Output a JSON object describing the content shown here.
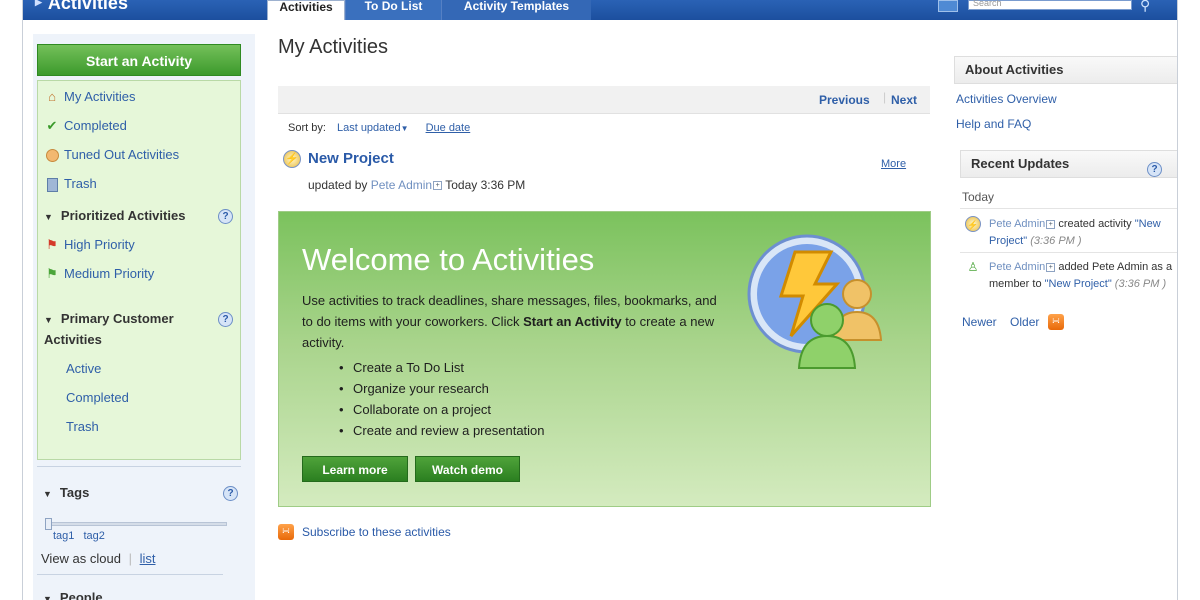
{
  "header": {
    "app_title": "Activities",
    "tabs": [
      {
        "label": "Activities"
      },
      {
        "label": "To Do List"
      },
      {
        "label": "Activity Templates"
      }
    ],
    "search_placeholder": "Search"
  },
  "sidebar": {
    "start_button": "Start an Activity",
    "nav": [
      {
        "label": "My Activities",
        "icon": "home-icon"
      },
      {
        "label": "Completed",
        "icon": "checkmark-icon"
      },
      {
        "label": "Tuned Out Activities",
        "icon": "tuned-out-icon"
      },
      {
        "label": "Trash",
        "icon": "trash-icon"
      }
    ],
    "prioritized": {
      "title": "Prioritized Activities",
      "items": [
        {
          "label": "High Priority",
          "icon": "red-flag-icon"
        },
        {
          "label": "Medium Priority",
          "icon": "green-flag-icon"
        }
      ]
    },
    "primary": {
      "title": "Primary Customer Activities",
      "items": [
        {
          "label": "Active"
        },
        {
          "label": "Completed"
        },
        {
          "label": "Trash"
        }
      ]
    },
    "tags": {
      "title": "Tags",
      "tags": [
        "tag1",
        "tag2"
      ],
      "view_as_cloud": "View as cloud",
      "list_link": "list"
    },
    "people": {
      "title": "People"
    }
  },
  "main": {
    "title": "My Activities",
    "pager": {
      "previous": "Previous",
      "next": "Next"
    },
    "sort": {
      "label": "Sort by:",
      "last_updated": "Last updated",
      "due_date": "Due date"
    },
    "activity": {
      "title": "New Project",
      "updated_by": "updated by",
      "user": "Pete Admin",
      "time": "Today 3:36 PM",
      "more": "More"
    },
    "welcome": {
      "title": "Welcome to Activities",
      "desc_start": "Use activities to track deadlines, share messages, files, bookmarks, and to do items with your coworkers. Click ",
      "desc_bold": "Start an Activity",
      "desc_end": " to create a new activity.",
      "bullets": [
        "Create a To Do List",
        "Organize your research",
        "Collaborate on a project",
        "Create and review a presentation"
      ],
      "learn_more": "Learn more",
      "watch_demo": "Watch demo"
    },
    "subscribe": "Subscribe to these activities"
  },
  "right": {
    "about_title": "About Activities",
    "links": [
      "Activities Overview",
      "Help and FAQ"
    ],
    "recent_title": "Recent Updates",
    "today": "Today",
    "updates": [
      {
        "user": "Pete Admin",
        "text1": " created activity ",
        "link": "\"New Project\"",
        "time": " (3:36 PM )"
      },
      {
        "user": "Pete Admin",
        "text1": " added Pete Admin as a member to ",
        "link": "\"New Project\"",
        "time": " (3:36 PM )"
      }
    ],
    "newer": "Newer",
    "older": "Older"
  },
  "colors": {
    "accent": "#1c4f9e",
    "green": "#3c9a2c",
    "link": "#2f5fa8"
  }
}
